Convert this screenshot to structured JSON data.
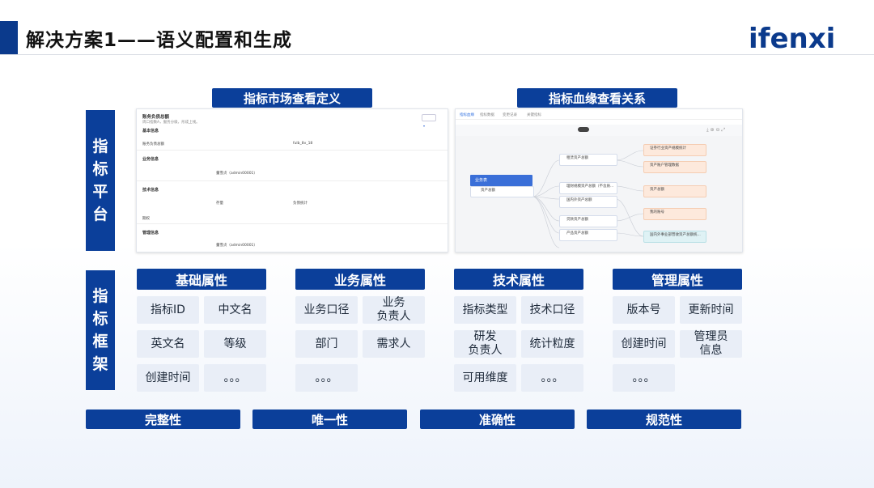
{
  "header": {
    "title": "解决方案1——语义配置和生成",
    "logo": "ifenxi"
  },
  "top_buttons": {
    "market": "指标市场查看定义",
    "lineage": "指标血缘查看关系"
  },
  "side_labels": {
    "platform": [
      "指",
      "标",
      "平",
      "台"
    ],
    "framework": [
      "指",
      "标",
      "框",
      "架"
    ]
  },
  "categories": [
    {
      "title": "基础属性",
      "items": [
        "指标ID",
        "中文名",
        "英文名",
        "等级",
        "创建时间",
        "。。。"
      ]
    },
    {
      "title": "业务属性",
      "items": [
        "业务口径",
        "业务\n负责人",
        "部门",
        "需求人",
        "。。。"
      ]
    },
    {
      "title": "技术属性",
      "items": [
        "指标类型",
        "技术口径",
        "研发\n负责人",
        "统计粒度",
        "可用维度",
        "。。。"
      ]
    },
    {
      "title": "管理属性",
      "items": [
        "版本号",
        "更新时间",
        "创建时间",
        "管理员\n信息",
        "。。。"
      ]
    }
  ],
  "bottom_buttons": [
    "完整性",
    "唯一性",
    "准确性",
    "规范性"
  ],
  "market_shot": {
    "name": "账务负债总额",
    "sections": [
      "基本信息",
      "业务信息",
      "技术信息",
      "管理信息"
    ],
    "values": [
      "账务负债总额",
      "fulb_8v_18",
      "周口指数A，服务分级，形成上线。",
      "董雪贞（admin00001）",
      "存量",
      "负债统计",
      "期权",
      "董雪贞（admin00001）"
    ]
  },
  "lineage_shot": {
    "tabs": [
      "指标血缘",
      "指标数据",
      "变更记录",
      "关键指标"
    ],
    "root": "业务表",
    "nodes": [
      "资产总额",
      "租赁资产总额",
      "理财规模资产总额（不含质...",
      "国内外资产总额",
      "贷款资产总额",
      "产品资产总额"
    ],
    "right_nodes": [
      "证券行业资产规模统计",
      "资产账户管理数据",
      "资产总额",
      "我的账号",
      "国内外事业部营收资产总额统..."
    ]
  }
}
